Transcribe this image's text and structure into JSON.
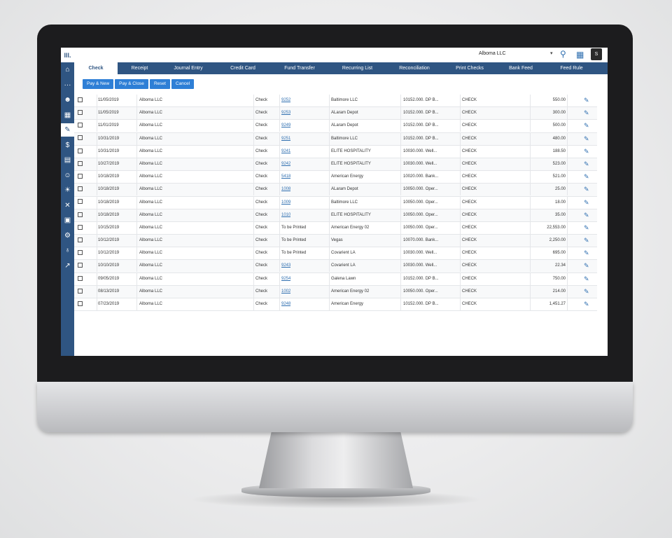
{
  "topbar": {
    "company": "Alboma LLC",
    "user_initial": "S"
  },
  "tabs": [
    "Check",
    "Receipt",
    "Journal Entry",
    "Credit Card",
    "Fund Transfer",
    "Recurring List",
    "Reconciliation",
    "Print Checks",
    "Bank Feed",
    "Feed Rule"
  ],
  "active_tab": "Check",
  "actions": [
    "Pay & New",
    "Pay & Close",
    "Reset",
    "Cancel"
  ],
  "sidebar": {
    "logo": "lll.",
    "icons": [
      "home-icon",
      "more-icon",
      "person-icon",
      "building-icon",
      "check-document-icon",
      "hand-coin-icon",
      "invoice-icon",
      "person-gear-icon",
      "lightbulb-icon",
      "tools-icon",
      "document-icon",
      "gear-icon",
      "money-bag-icon",
      "chart-icon"
    ],
    "active_index": 4
  },
  "rows": [
    {
      "date": "11/05/2019",
      "company": "Alboma LLC",
      "type": "Check",
      "ref": "9252",
      "ref_link": true,
      "payee": "Baltimore LLC",
      "account": "10152.000. DP B...",
      "method": "CHECK",
      "amount": "550.00"
    },
    {
      "date": "11/05/2019",
      "company": "Alboma LLC",
      "type": "Check",
      "ref": "9253",
      "ref_link": true,
      "payee": "ALaram Depot",
      "account": "10152.000. DP B...",
      "method": "CHECK",
      "amount": "300.00"
    },
    {
      "date": "11/01/2019",
      "company": "Alboma LLC",
      "type": "Check",
      "ref": "9249",
      "ref_link": true,
      "payee": "ALaram Depot",
      "account": "10152.000. DP B...",
      "method": "CHECK",
      "amount": "500.00"
    },
    {
      "date": "10/31/2019",
      "company": "Alboma LLC",
      "type": "Check",
      "ref": "9251",
      "ref_link": true,
      "payee": "Baltimore LLC",
      "account": "10152.000. DP B...",
      "method": "CHECK",
      "amount": "480.00"
    },
    {
      "date": "10/31/2019",
      "company": "Alboma LLC",
      "type": "Check",
      "ref": "9241",
      "ref_link": true,
      "payee": "ELITE HOSPITALITY",
      "account": "10030.000. Well...",
      "method": "CHECK",
      "amount": "188.50"
    },
    {
      "date": "10/27/2019",
      "company": "Alboma LLC",
      "type": "Check",
      "ref": "9242",
      "ref_link": true,
      "payee": "ELITE HOSPITALITY",
      "account": "10030.000. Well...",
      "method": "CHECK",
      "amount": "523.00"
    },
    {
      "date": "10/18/2019",
      "company": "Alboma LLC",
      "type": "Check",
      "ref": "5418",
      "ref_link": true,
      "payee": "American Energy",
      "account": "10020.000. Bank...",
      "method": "CHECK",
      "amount": "521.00"
    },
    {
      "date": "10/18/2019",
      "company": "Alboma LLC",
      "type": "Check",
      "ref": "1008",
      "ref_link": true,
      "payee": "ALaram Depot",
      "account": "10050.000. Oper...",
      "method": "CHECK",
      "amount": "25.00"
    },
    {
      "date": "10/18/2019",
      "company": "Alboma LLC",
      "type": "Check",
      "ref": "1009",
      "ref_link": true,
      "payee": "Baltimore LLC",
      "account": "10050.000. Oper...",
      "method": "CHECK",
      "amount": "18.00"
    },
    {
      "date": "10/18/2019",
      "company": "Alboma LLC",
      "type": "Check",
      "ref": "1010",
      "ref_link": true,
      "payee": "ELITE HOSPITALITY",
      "account": "10050.000. Oper...",
      "method": "CHECK",
      "amount": "35.00"
    },
    {
      "date": "10/15/2019",
      "company": "Alboma LLC",
      "type": "Check",
      "ref": "To be Printed",
      "ref_link": false,
      "payee": "American Energy 02",
      "account": "10050.000. Oper...",
      "method": "CHECK",
      "amount": "22,553.00"
    },
    {
      "date": "10/12/2019",
      "company": "Alboma LLC",
      "type": "Check",
      "ref": "To be Printed",
      "ref_link": false,
      "payee": "Vegas",
      "account": "10070.000. Bank...",
      "method": "CHECK",
      "amount": "2,250.00"
    },
    {
      "date": "10/12/2019",
      "company": "Alboma LLC",
      "type": "Check",
      "ref": "To be Printed",
      "ref_link": false,
      "payee": "Covarient LA",
      "account": "10030.000. Well...",
      "method": "CHECK",
      "amount": "695.00"
    },
    {
      "date": "10/10/2019",
      "company": "Alboma LLC",
      "type": "Check",
      "ref": "9243",
      "ref_link": true,
      "payee": "Covarient LA",
      "account": "10030.000. Well...",
      "method": "CHECK",
      "amount": "22.34"
    },
    {
      "date": "09/05/2019",
      "company": "Alboma LLC",
      "type": "Check",
      "ref": "9254",
      "ref_link": true,
      "payee": "Galena Lawn",
      "account": "10152.000. DP B...",
      "method": "CHECK",
      "amount": "750.00"
    },
    {
      "date": "08/13/2019",
      "company": "Alboma LLC",
      "type": "Check",
      "ref": "1002",
      "ref_link": true,
      "payee": "American Energy 02",
      "account": "10050.000. Oper...",
      "method": "CHECK",
      "amount": "214.00"
    },
    {
      "date": "07/23/2019",
      "company": "Alboma LLC",
      "type": "Check",
      "ref": "9248",
      "ref_link": true,
      "payee": "American Energy",
      "account": "10152.000. DP B...",
      "method": "CHECK",
      "amount": "1,451.27"
    }
  ]
}
